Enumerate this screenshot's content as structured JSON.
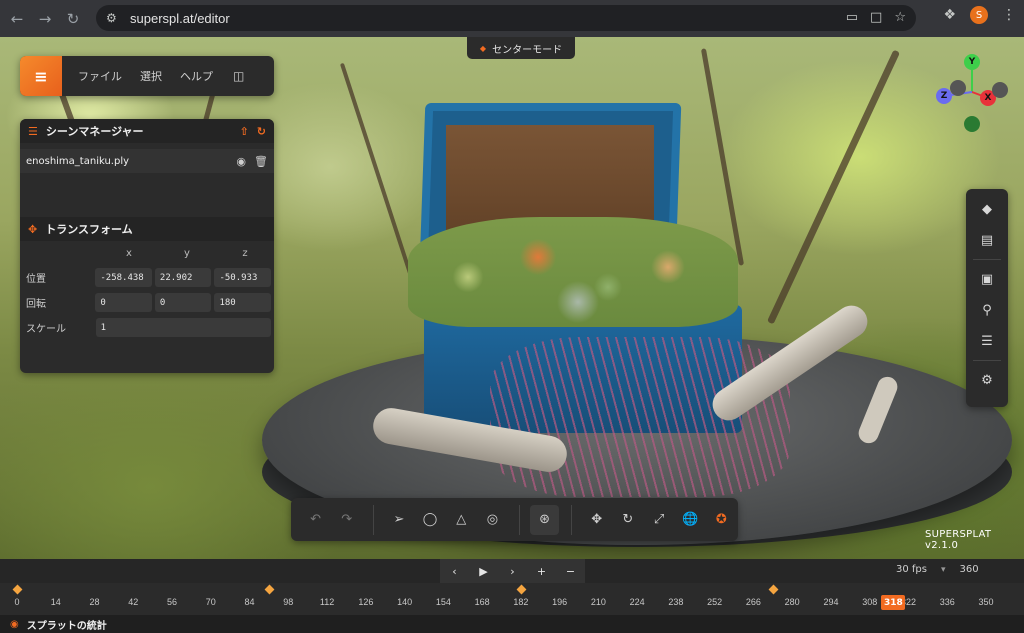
{
  "browser": {
    "url": "superspl.at/editor",
    "back_icon": "arrow-left-icon",
    "forward_icon": "arrow-right-icon",
    "reload_icon": "reload-icon",
    "profile_initial": "S",
    "profile_color": "#e8711c"
  },
  "menubar": {
    "logo": "supersplat-logo",
    "items": [
      {
        "label": "ファイル"
      },
      {
        "label": "選択"
      },
      {
        "label": "ヘルプ"
      }
    ]
  },
  "mode_pill": {
    "label": "センターモード"
  },
  "scene_manager": {
    "title": "シーンマネージャー",
    "items": [
      {
        "name": "enoshima_taniku.ply"
      }
    ]
  },
  "transform": {
    "title": "トランスフォーム",
    "axes": [
      "x",
      "y",
      "z"
    ],
    "position": {
      "label": "位置",
      "values": [
        "-258.438",
        "22.902",
        "-50.933"
      ]
    },
    "rotation": {
      "label": "回転",
      "values": [
        "0",
        "0",
        "180"
      ]
    },
    "scale": {
      "label": "スケール",
      "value": "1"
    }
  },
  "gizmo": {
    "y": {
      "label": "Y",
      "color": "#3ecf4a"
    },
    "x": {
      "label": "X",
      "color": "#e8323a"
    },
    "z": {
      "label": "Z",
      "color": "#6a6cf0"
    }
  },
  "version": "SUPERSPLAT v2.1.0",
  "accent_color": "#f26b21",
  "timeline": {
    "fps": "30 fps",
    "frames": "360",
    "current_frame": "318",
    "ticks": [
      "0",
      "14",
      "28",
      "42",
      "56",
      "70",
      "84",
      "98",
      "112",
      "126",
      "140",
      "154",
      "168",
      "182",
      "196",
      "210",
      "224",
      "238",
      "252",
      "266",
      "280",
      "294",
      "308",
      "322",
      "336",
      "350"
    ],
    "keyframes": [
      0,
      91,
      182,
      273
    ]
  },
  "stats": {
    "label": "スプラットの統計"
  }
}
